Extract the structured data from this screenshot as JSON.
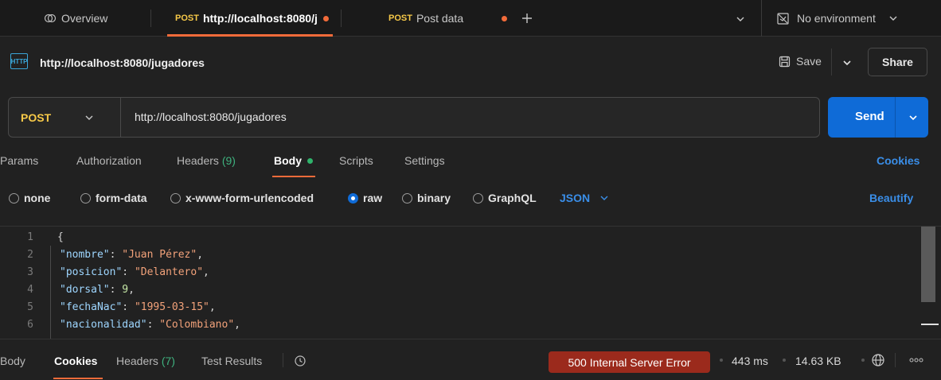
{
  "tabs": {
    "overview_label": "Overview",
    "tab1_method": "POST",
    "tab1_label": "http://localhost:8080/j",
    "tab2_method": "POST",
    "tab2_label": "Post data",
    "environment_label": "No environment"
  },
  "request": {
    "title": "http://localhost:8080/jugadores",
    "icon_label": "HTTP",
    "save_label": "Save",
    "share_label": "Share",
    "method": "POST",
    "url": "http://localhost:8080/jugadores",
    "send_label": "Send"
  },
  "request_tabs": {
    "params": "Params",
    "authorization": "Authorization",
    "headers": "Headers",
    "headers_count": "(9)",
    "body": "Body",
    "scripts": "Scripts",
    "settings": "Settings",
    "cookies": "Cookies"
  },
  "body_options": {
    "none": "none",
    "form_data": "form-data",
    "urlencoded": "x-www-form-urlencoded",
    "raw": "raw",
    "binary": "binary",
    "graphql": "GraphQL",
    "format": "JSON",
    "beautify": "Beautify",
    "selected": "raw"
  },
  "editor": {
    "line_numbers": [
      "1",
      "2",
      "3",
      "4",
      "5",
      "6"
    ],
    "brace": "{",
    "fields": [
      {
        "key": "\"nombre\"",
        "value": "\"Juan Pérez\"",
        "type": "string"
      },
      {
        "key": "\"posicion\"",
        "value": "\"Delantero\"",
        "type": "string"
      },
      {
        "key": "\"dorsal\"",
        "value": "9",
        "type": "number"
      },
      {
        "key": "\"fechaNac\"",
        "value": "\"1995-03-15\"",
        "type": "string"
      },
      {
        "key": "\"nacionalidad\"",
        "value": "\"Colombiano\"",
        "type": "string"
      }
    ]
  },
  "response": {
    "body_tab": "Body",
    "cookies_tab": "Cookies",
    "headers_tab": "Headers",
    "headers_count": "(7)",
    "test_results_tab": "Test Results",
    "status": "500 Internal Server Error",
    "time": "443 ms",
    "size": "14.63 KB"
  },
  "colors": {
    "accent_blue": "#0f6bd7",
    "method_post": "#f7c948",
    "error_badge": "#9b2a1c",
    "active_dot": "#2fb36b",
    "unsaved_dot": "#f26b3a"
  }
}
